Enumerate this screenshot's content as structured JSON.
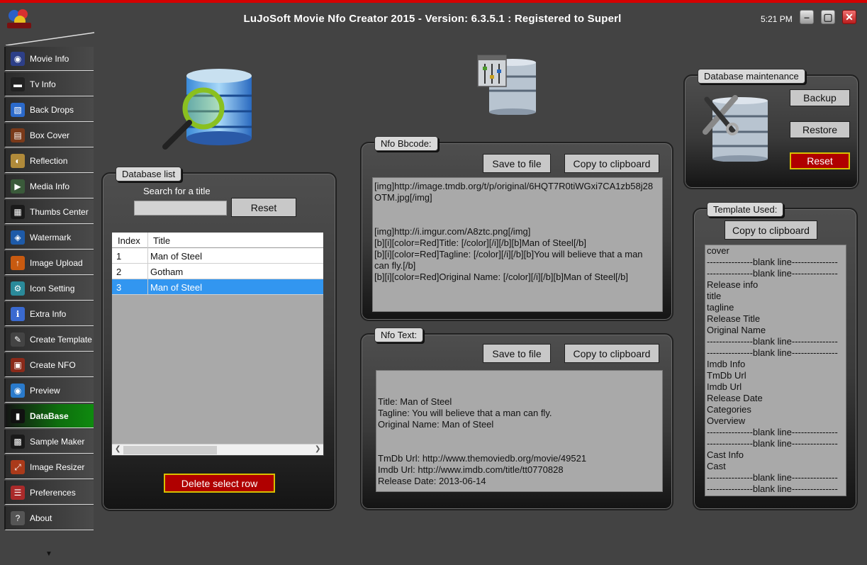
{
  "window": {
    "title": "LuJoSoft Movie Nfo Creator 2015 - Version: 6.3.5.1 : Registered to Superl",
    "clock": "5:21 PM",
    "minimize": "–",
    "maximize": "▢",
    "close": "✕"
  },
  "sidebar": {
    "items": [
      {
        "label": "Movie Info",
        "icon": "film-reel-icon",
        "color": "#2d3f88",
        "glyph": "◉"
      },
      {
        "label": "Tv Info",
        "icon": "tv-icon",
        "color": "#222222",
        "glyph": "▬"
      },
      {
        "label": "Back Drops",
        "icon": "backdrop-icon",
        "color": "#2b6acb",
        "glyph": "▧"
      },
      {
        "label": "Box Cover",
        "icon": "box-cover-icon",
        "color": "#7a3a1a",
        "glyph": "▤"
      },
      {
        "label": "Reflection",
        "icon": "reflection-icon",
        "color": "#b08a3a",
        "glyph": "◐"
      },
      {
        "label": "Media Info",
        "icon": "media-info-icon",
        "color": "#3a5a3a",
        "glyph": "▶"
      },
      {
        "label": "Thumbs Center",
        "icon": "thumbs-icon",
        "color": "#1a1a1a",
        "glyph": "▦"
      },
      {
        "label": "Watermark",
        "icon": "watermark-icon",
        "color": "#1d5aa8",
        "glyph": "◈"
      },
      {
        "label": "Image Upload",
        "icon": "upload-icon",
        "color": "#c85a10",
        "glyph": "↑"
      },
      {
        "label": "Icon Setting",
        "icon": "gear-icon",
        "color": "#2a8a9a",
        "glyph": "⚙"
      },
      {
        "label": "Extra Info",
        "icon": "extra-info-icon",
        "color": "#3a6ad0",
        "glyph": "ℹ"
      },
      {
        "label": "Create Template",
        "icon": "template-icon",
        "color": "#444444",
        "glyph": "✎"
      },
      {
        "label": "Create NFO",
        "icon": "nfo-icon",
        "color": "#8a2a1a",
        "glyph": "▣"
      },
      {
        "label": "Preview",
        "icon": "eye-icon",
        "color": "#2a7acb",
        "glyph": "◉"
      },
      {
        "label": "DataBase",
        "icon": "database-icon",
        "color": "#111111",
        "glyph": "▮"
      },
      {
        "label": "Sample Maker",
        "icon": "clapper-icon",
        "color": "#1a1a1a",
        "glyph": "▩"
      },
      {
        "label": "Image Resizer",
        "icon": "resize-icon",
        "color": "#aa3a1a",
        "glyph": "⤢"
      },
      {
        "label": "Preferences",
        "icon": "preferences-icon",
        "color": "#aa2a2a",
        "glyph": "☰"
      },
      {
        "label": "About",
        "icon": "about-icon",
        "color": "#555555",
        "glyph": "?"
      }
    ],
    "active_index": 14,
    "more_arrow": "▼"
  },
  "database_list": {
    "tab": "Database list",
    "search_label": "Search for a title",
    "search_value": "",
    "reset_label": "Reset",
    "columns": [
      "Index",
      "Title"
    ],
    "rows": [
      {
        "index": "1",
        "title": "Man of Steel"
      },
      {
        "index": "2",
        "title": "Gotham"
      },
      {
        "index": "3",
        "title": "Man of Steel"
      }
    ],
    "selected_row": 2,
    "delete_label": "Delete select row"
  },
  "nfo_bbcode": {
    "tab": "Nfo Bbcode:",
    "save_label": "Save to file",
    "copy_label": "Copy to clipboard",
    "lines": [
      "[img]http://image.tmdb.org/t/p/original/6HQT7R0tiWGxi7CA1zb58j28",
      "OTM.jpg[/img]",
      "",
      "",
      "[img]http://i.imgur.com/A8ztc.png[/img]",
      "[b][i][color=Red]Title: [/color][/i][/b][b]Man of Steel[/b]",
      "[b][i][color=Red]Tagline: [/color][/i][/b][b]You will believe that a man",
      "can fly.[/b]",
      "[b][i][color=Red]Original Name: [/color][/i][/b][b]Man of Steel[/b]"
    ]
  },
  "nfo_text": {
    "tab": "Nfo Text:",
    "save_label": "Save to file",
    "copy_label": "Copy to clipboard",
    "lines": [
      "",
      "",
      "Title: Man of Steel",
      "Tagline: You will believe that a man can fly.",
      "Original Name: Man of Steel",
      "",
      "",
      "TmDb Url: http://www.themoviedb.org/movie/49521",
      "Imdb Url: http://www.imdb.com/title/tt0770828",
      "Release Date: 2013-06-14"
    ]
  },
  "db_maintenance": {
    "tab": "Database maintenance",
    "backup_label": "Backup",
    "restore_label": "Restore",
    "reset_label": "Reset"
  },
  "template_used": {
    "tab": "Template Used:",
    "copy_label": "Copy to clipboard",
    "lines": [
      "cover",
      "---------------blank line---------------",
      "---------------blank line---------------",
      "Release info",
      "title",
      "tagline",
      "Release Title",
      "Original Name",
      "---------------blank line---------------",
      "---------------blank line---------------",
      "Imdb Info",
      "TmDb Url",
      "Imdb Url",
      "Release Date",
      "Categories",
      "Overview",
      "---------------blank line---------------",
      "---------------blank line---------------",
      "Cast Info",
      "Cast",
      "---------------blank line---------------",
      "---------------blank line---------------"
    ]
  },
  "colors": {
    "background": "#434343",
    "accent_red": "#b00000",
    "active_green": "#0f8a0f",
    "selection_blue": "#3296f0"
  }
}
